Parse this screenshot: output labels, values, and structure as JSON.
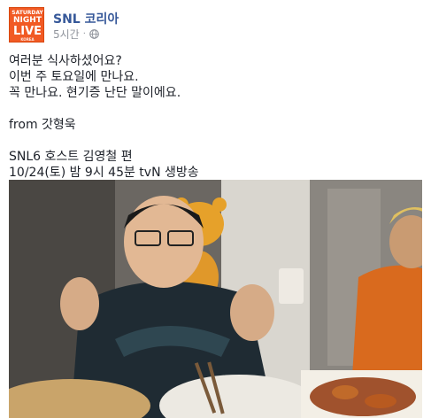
{
  "post": {
    "page_name": "SNL 코리아",
    "timestamp": "5시간",
    "privacy_icon": "globe-icon",
    "avatar_logo": {
      "line1": "SATURDAY",
      "line2": "NIGHT",
      "line3": "LIVE",
      "line4": "KOREA"
    },
    "body": {
      "paragraph1": [
        "여러분 식사하셨어요?",
        "이번 주 토요일에 만나요.",
        "꼭 만나요. 현기증 난단 말이에요."
      ],
      "paragraph2": [
        "from 갓형욱"
      ],
      "paragraph3": [
        "SNL6 호스트 김영철 편",
        "10/24(토) 밤 9시 45분 tvN 생방송"
      ]
    }
  },
  "colors": {
    "link": "#365899",
    "meta": "#90949c",
    "text": "#1d2129",
    "brand_orange": "#f15a24"
  }
}
